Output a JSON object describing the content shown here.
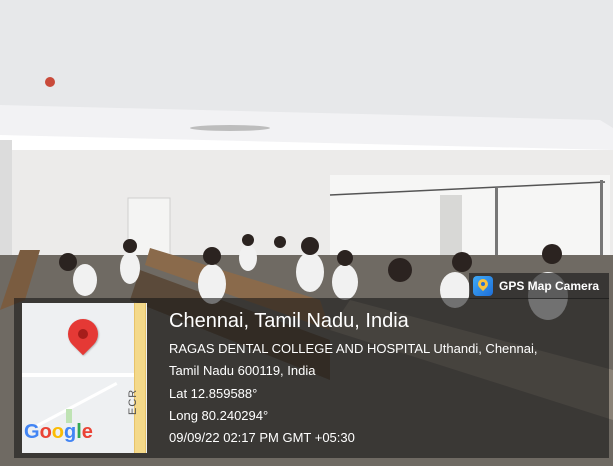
{
  "gps_tag": {
    "label": "GPS Map Camera",
    "icon": "gps-map-camera-app-icon"
  },
  "map": {
    "road_label": "ECR",
    "logo_letters": [
      "G",
      "o",
      "o",
      "g",
      "l",
      "e"
    ],
    "logo_colors": [
      "#4285F4",
      "#EA4335",
      "#FBBC05",
      "#4285F4",
      "#34A853",
      "#EA4335"
    ],
    "pin_color": "#e53935",
    "pin_icon": "map-pin-icon"
  },
  "location": {
    "title": "Chennai, Tamil Nadu, India",
    "address_line1": "RAGAS DENTAL COLLEGE AND HOSPITAL Uthandi, Chennai,",
    "address_line2": "Tamil Nadu 600119, India",
    "latitude": "Lat 12.859588°",
    "longitude": "Long 80.240294°",
    "timestamp": "09/09/22 02:17 PM GMT +05:30"
  }
}
